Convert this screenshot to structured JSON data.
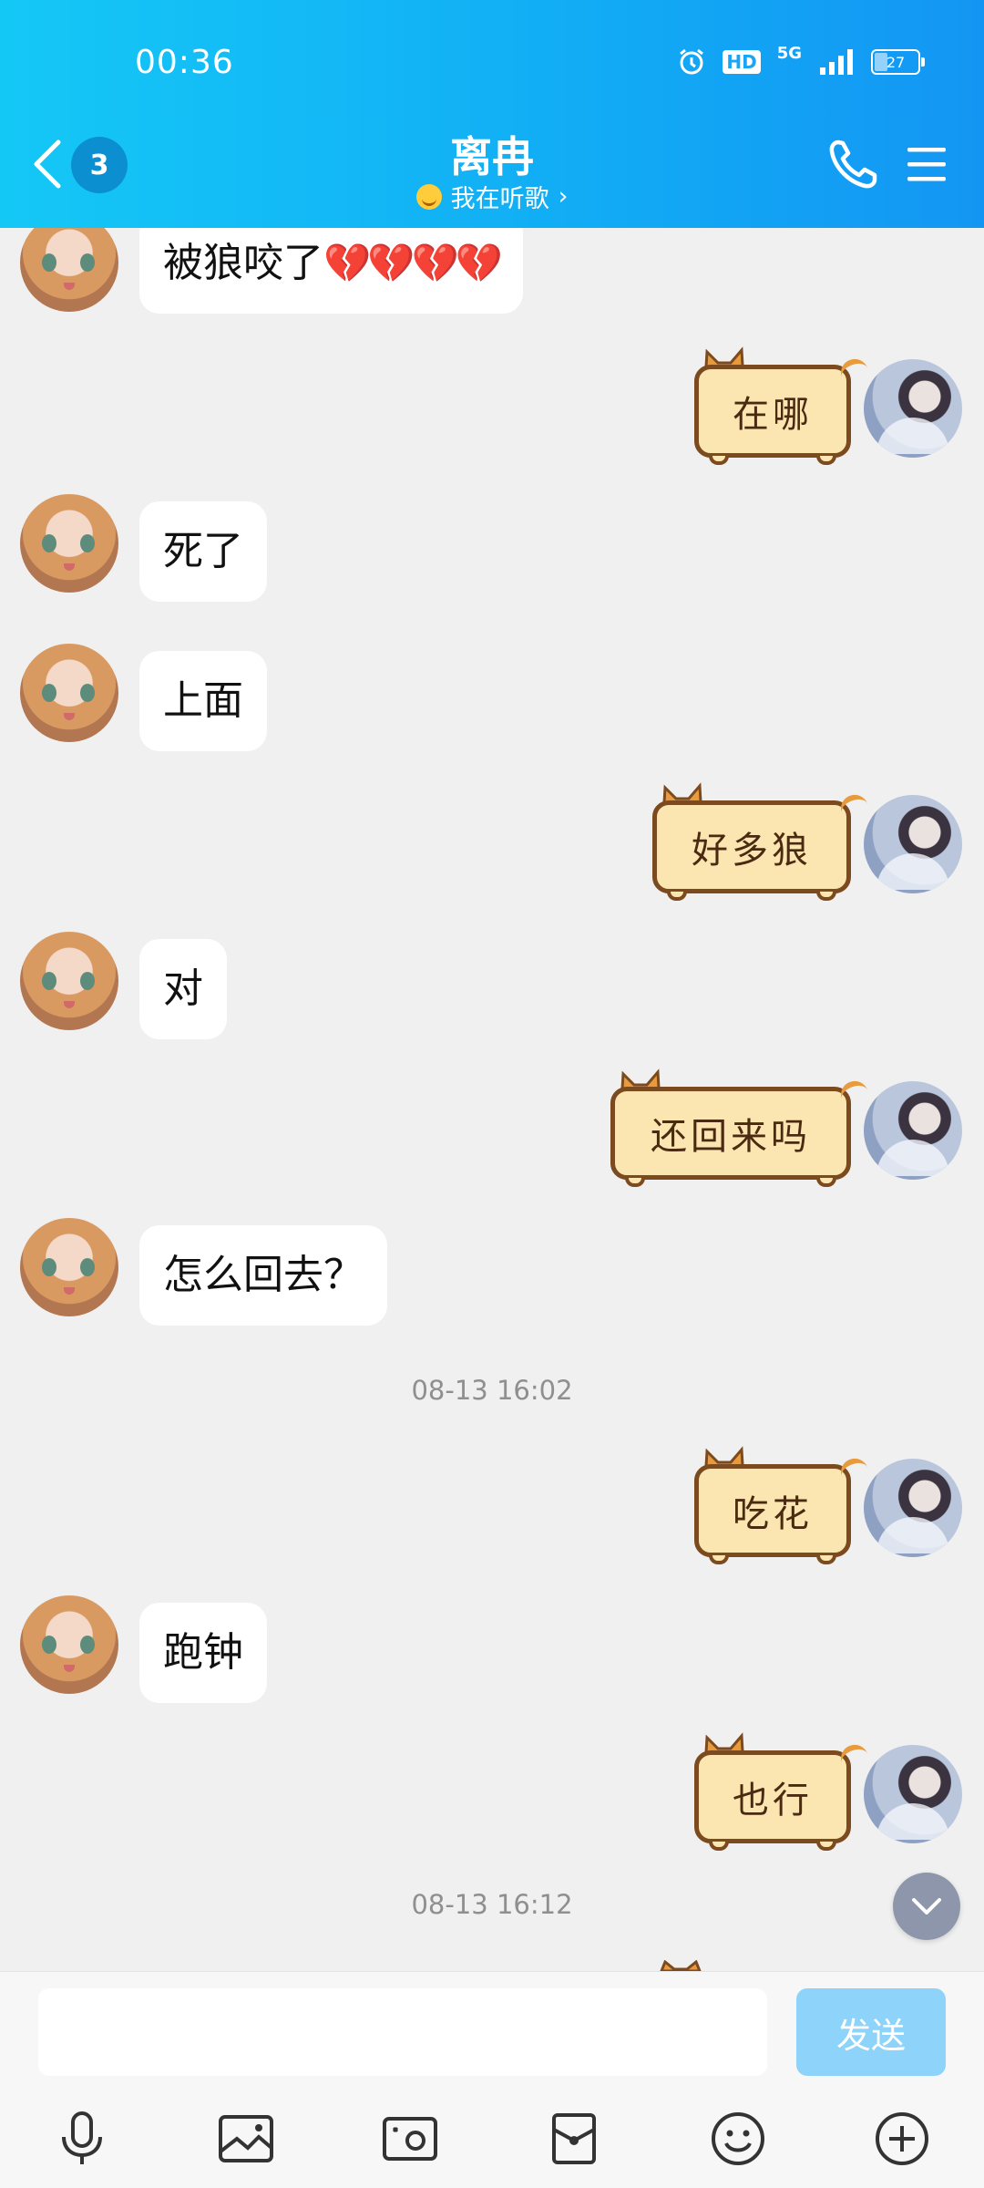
{
  "status_bar": {
    "time": "00:36",
    "hd": "HD",
    "network": "5G",
    "battery": "27"
  },
  "header": {
    "back_badge": "3",
    "title": "离冉",
    "subtitle": "我在听歌"
  },
  "messages": [
    {
      "side": "left",
      "type": "text",
      "text": "被狼咬了",
      "emoji": "💔💔💔💔"
    },
    {
      "side": "right",
      "type": "sticker",
      "text": "在哪"
    },
    {
      "side": "left",
      "type": "text",
      "text": "死了"
    },
    {
      "side": "left",
      "type": "text",
      "text": "上面"
    },
    {
      "side": "right",
      "type": "sticker",
      "text": "好多狼"
    },
    {
      "side": "left",
      "type": "text",
      "text": "对"
    },
    {
      "side": "right",
      "type": "sticker",
      "text": "还回来吗"
    },
    {
      "side": "left",
      "type": "text",
      "text": "怎么回去？"
    },
    {
      "type": "timestamp",
      "text": "08-13 16:02"
    },
    {
      "side": "right",
      "type": "sticker",
      "text": "吃花"
    },
    {
      "side": "left",
      "type": "text",
      "text": "跑钟"
    },
    {
      "side": "right",
      "type": "sticker",
      "text": "也行"
    },
    {
      "type": "timestamp",
      "text": "08-13 16:12"
    }
  ],
  "composer": {
    "input_value": "",
    "send_label": "发送"
  },
  "toolbar_icons": [
    "microphone-icon",
    "image-icon",
    "camera-icon",
    "red-packet-icon",
    "emoji-icon",
    "plus-icon"
  ],
  "colors": {
    "header_start": "#14c8f6",
    "header_end": "#1396f3",
    "send_button": "#8ed3fa"
  }
}
